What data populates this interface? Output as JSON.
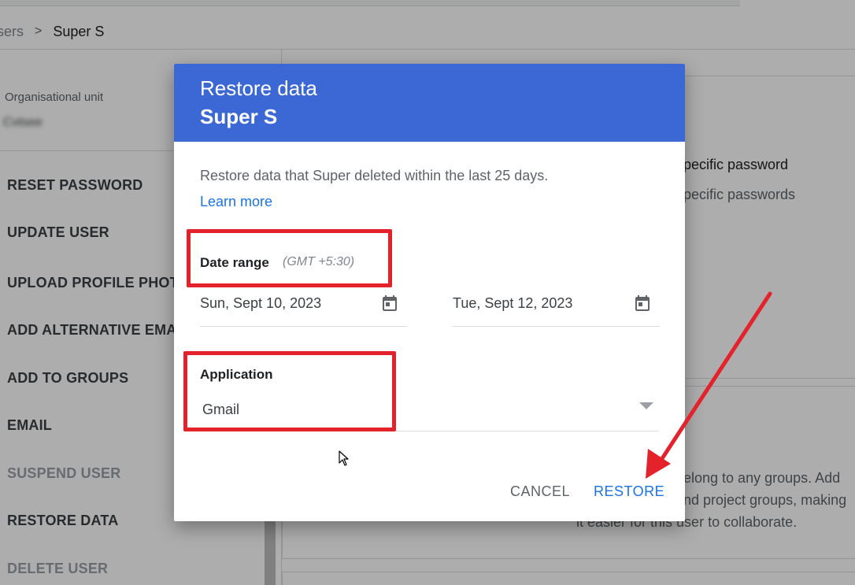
{
  "breadcrumb": {
    "previous": "Users",
    "previous_visible": "sers",
    "separator": ">",
    "current": "Super S"
  },
  "left_panel": {
    "ou_label": "Organisational unit",
    "ou_value": "Cvtsee",
    "actions": [
      {
        "label": "RESET PASSWORD",
        "disabled": false
      },
      {
        "label": "UPDATE USER",
        "disabled": false
      },
      {
        "label": "UPLOAD PROFILE PHOTO",
        "disabled": false
      },
      {
        "label": "ADD ALTERNATIVE EMAIL",
        "disabled": false
      },
      {
        "label": "ADD TO GROUPS",
        "disabled": false
      },
      {
        "label": "EMAIL",
        "disabled": false
      },
      {
        "label": "SUSPEND USER",
        "disabled": true
      },
      {
        "label": "RESTORE DATA",
        "disabled": false
      },
      {
        "label": "DELETE USER",
        "disabled": true
      }
    ]
  },
  "background": {
    "password_title": "pecific password",
    "password_subtitle": "pecific passwords",
    "groups_line1": "elong to any groups. Add",
    "groups_line2": "nd project groups, making",
    "groups_line3": "it easier for this user to collaborate."
  },
  "dialog": {
    "title": "Restore data",
    "subtitle": "Super S",
    "description": "Restore data that Super deleted within the last 25 days.",
    "learn_more": "Learn more",
    "date_range_label": "Date range",
    "timezone": "(GMT +5:30)",
    "start_date": "Sun, Sept 10, 2023",
    "end_date": "Tue, Sept 12, 2023",
    "application_label": "Application",
    "application_value": "Gmail",
    "cancel_label": "CANCEL",
    "restore_label": "RESTORE"
  },
  "colors": {
    "header_blue": "#3b68d4",
    "link_blue": "#1a73e8",
    "annotation_red": "#e3222c"
  }
}
